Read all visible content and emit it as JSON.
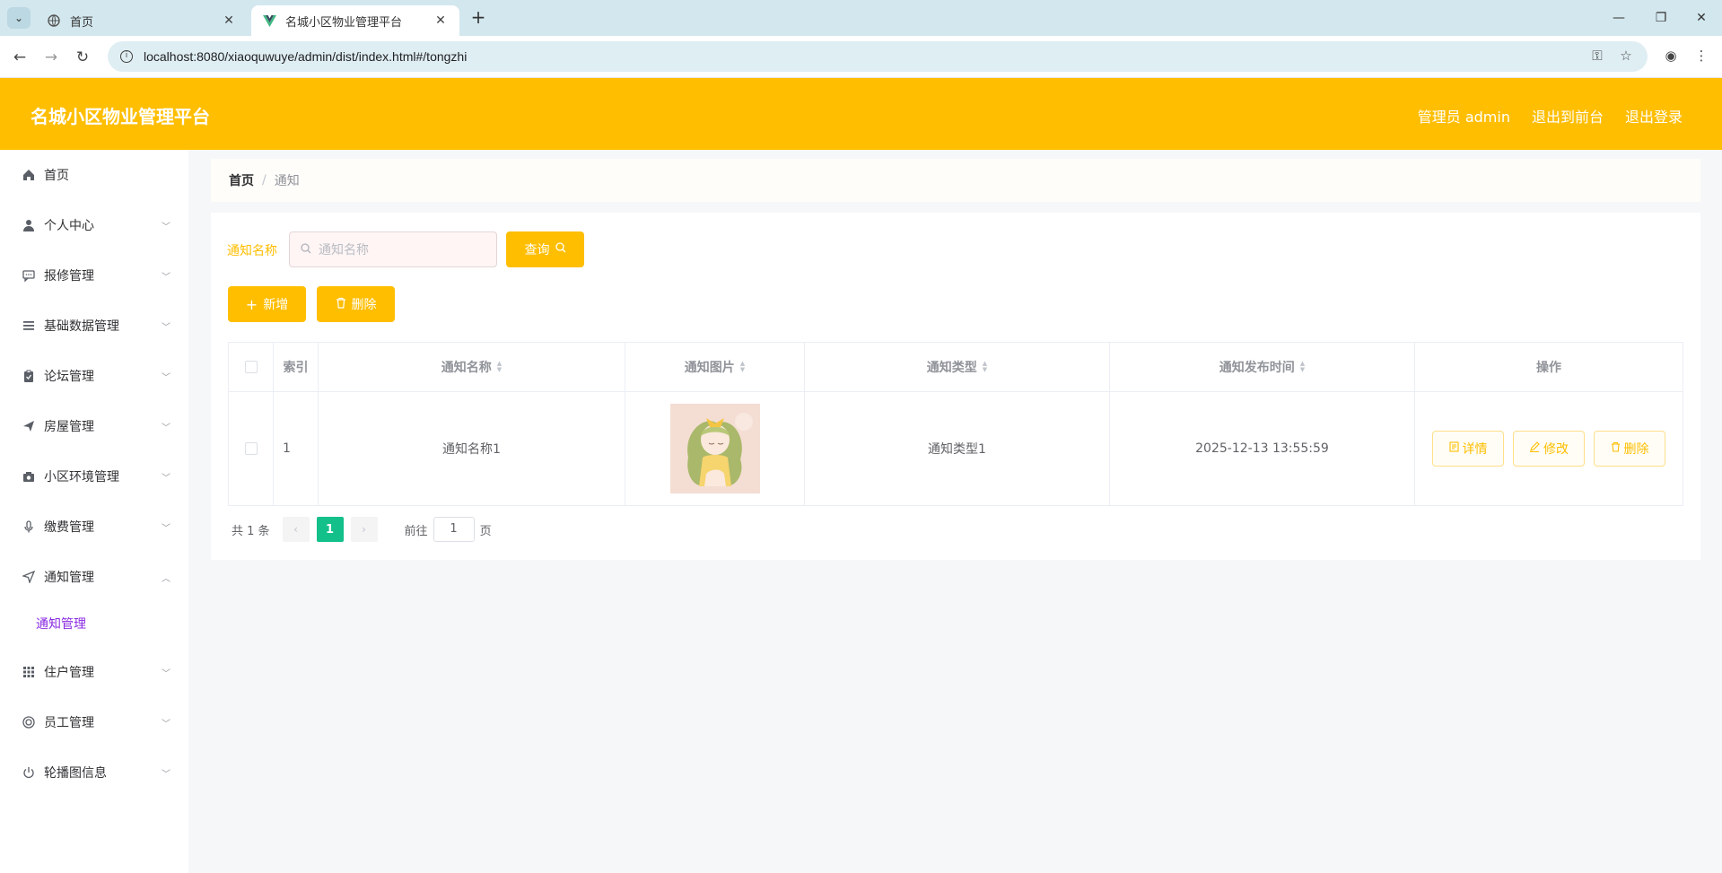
{
  "browser": {
    "tabs": [
      {
        "title": "首页",
        "active": false
      },
      {
        "title": "名城小区物业管理平台",
        "active": true
      }
    ],
    "url": "localhost:8080/xiaoquwuye/admin/dist/index.html#/tongzhi"
  },
  "header": {
    "title": "名城小区物业管理平台",
    "user": "管理员 admin",
    "to_front": "退出到前台",
    "logout": "退出登录"
  },
  "sidebar": {
    "items": [
      {
        "label": "首页",
        "icon": "home-icon"
      },
      {
        "label": "个人中心",
        "icon": "user-icon"
      },
      {
        "label": "报修管理",
        "icon": "chat-icon"
      },
      {
        "label": "基础数据管理",
        "icon": "menu-icon"
      },
      {
        "label": "论坛管理",
        "icon": "clipboard-icon"
      },
      {
        "label": "房屋管理",
        "icon": "send-icon"
      },
      {
        "label": "小区环境管理",
        "icon": "camera-icon"
      },
      {
        "label": "缴费管理",
        "icon": "microphone-icon"
      },
      {
        "label": "通知管理",
        "icon": "location-icon"
      },
      {
        "label": "住户管理",
        "icon": "grid-icon"
      },
      {
        "label": "员工管理",
        "icon": "help-icon"
      },
      {
        "label": "轮播图信息",
        "icon": "power-icon"
      }
    ],
    "submenu": {
      "label": "通知管理"
    }
  },
  "breadcrumb": {
    "home": "首页",
    "separator": "/",
    "current": "通知"
  },
  "search": {
    "label": "通知名称",
    "placeholder": "通知名称",
    "query_button": "查询"
  },
  "actions": {
    "add": "新增",
    "delete": "删除"
  },
  "table": {
    "headers": {
      "index": "索引",
      "name": "通知名称",
      "image": "通知图片",
      "type": "通知类型",
      "time": "通知发布时间",
      "ops": "操作"
    },
    "rows": [
      {
        "index": "1",
        "name": "通知名称1",
        "type": "通知类型1",
        "time": "2025-12-13 13:55:59"
      }
    ],
    "row_actions": {
      "detail": "详情",
      "edit": "修改",
      "delete": "删除"
    }
  },
  "pagination": {
    "total": "共 1 条",
    "current": "1",
    "goto_label": "前往",
    "goto_value": "1",
    "page_suffix": "页"
  },
  "colors": {
    "accent": "#ffbe00",
    "active_page": "#13c08a",
    "submenu_active": "#8a2be2"
  }
}
